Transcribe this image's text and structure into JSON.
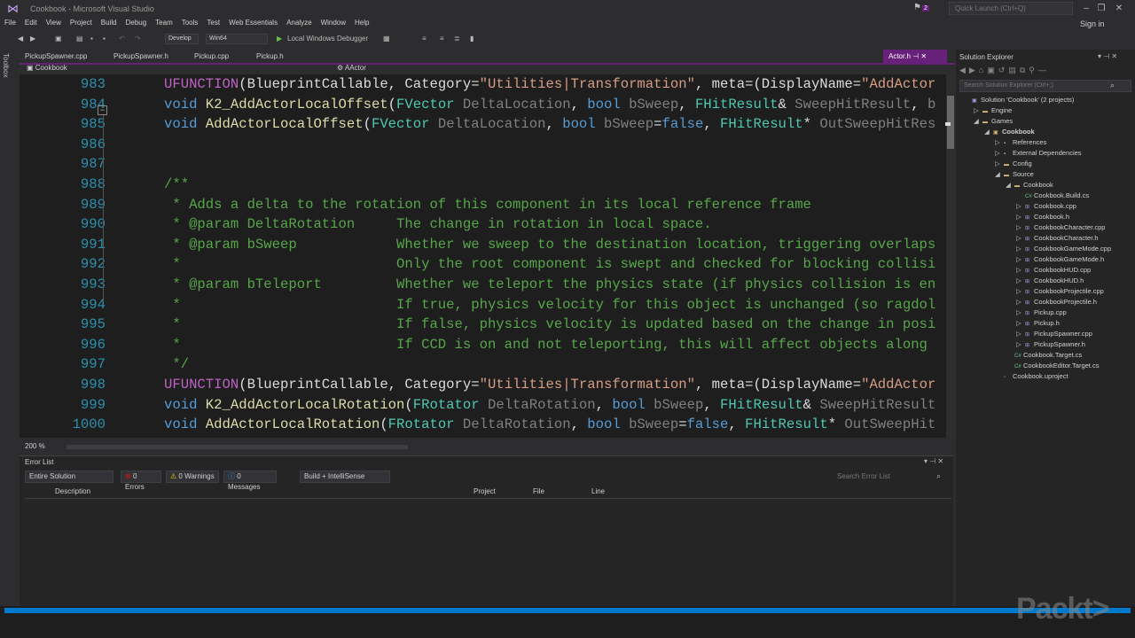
{
  "window": {
    "title": "Cookbook - Microsoft Visual Studio",
    "quick_launch_placeholder": "Quick Launch (Ctrl+Q)",
    "notification_count": "2",
    "sign_in": "Sign in"
  },
  "menu": [
    "File",
    "Edit",
    "View",
    "Project",
    "Build",
    "Debug",
    "Team",
    "Tools",
    "Test",
    "Web Essentials",
    "Analyze",
    "Window",
    "Help"
  ],
  "toolbar": {
    "configuration": "Develop",
    "platform": "Win64",
    "debugger": "Local Windows Debugger"
  },
  "toolbox_label": "Toolbox",
  "tabs": [
    "PickupSpawner.cpp",
    "PickupSpawner.h",
    "Pickup.cpp",
    "Pickup.h"
  ],
  "active_tab": "Actor.h",
  "nav": {
    "project": "Cookbook",
    "scope": "AActor"
  },
  "editor": {
    "zoom": "200 %",
    "lines": [
      {
        "n": "983",
        "segs": [
          [
            "mc",
            "UFUNCTION"
          ],
          [
            "pl",
            "(BlueprintCallable, Category="
          ],
          [
            "st",
            "\"Utilities|Transformation\""
          ],
          [
            "pl",
            ", meta=(DisplayName="
          ],
          [
            "st",
            "\"AddActor"
          ]
        ]
      },
      {
        "n": "984",
        "segs": [
          [
            "kw",
            "void"
          ],
          [
            "pl",
            " "
          ],
          [
            "fn",
            "K2_AddActorLocalOffset"
          ],
          [
            "pl",
            "("
          ],
          [
            "ty",
            "FVector"
          ],
          [
            "pl",
            " "
          ],
          [
            "pm",
            "DeltaLocation"
          ],
          [
            "pl",
            ", "
          ],
          [
            "kw",
            "bool"
          ],
          [
            "pl",
            " "
          ],
          [
            "pm",
            "bSweep"
          ],
          [
            "pl",
            ", "
          ],
          [
            "ty",
            "FHitResult"
          ],
          [
            "pl",
            "& "
          ],
          [
            "pm",
            "SweepHitResult"
          ],
          [
            "pl",
            ", "
          ],
          [
            "pm",
            "b"
          ]
        ]
      },
      {
        "n": "985",
        "segs": [
          [
            "kw",
            "void"
          ],
          [
            "pl",
            " "
          ],
          [
            "fn",
            "AddActorLocalOffset"
          ],
          [
            "pl",
            "("
          ],
          [
            "ty",
            "FVector"
          ],
          [
            "pl",
            " "
          ],
          [
            "pm",
            "DeltaLocation"
          ],
          [
            "pl",
            ", "
          ],
          [
            "kw",
            "bool"
          ],
          [
            "pl",
            " "
          ],
          [
            "pm",
            "bSweep"
          ],
          [
            "pl",
            "="
          ],
          [
            "kw",
            "false"
          ],
          [
            "pl",
            ", "
          ],
          [
            "ty",
            "FHitResult"
          ],
          [
            "pl",
            "* "
          ],
          [
            "pm",
            "OutSweepHitRes"
          ]
        ]
      },
      {
        "n": "986",
        "segs": []
      },
      {
        "n": "987",
        "segs": []
      },
      {
        "n": "988",
        "segs": [
          [
            "cm",
            "/**"
          ]
        ]
      },
      {
        "n": "989",
        "segs": [
          [
            "cm",
            " * Adds a delta to the rotation of this component in its local reference frame"
          ]
        ]
      },
      {
        "n": "990",
        "segs": [
          [
            "cm",
            " * @param DeltaRotation     The change in rotation in local space."
          ]
        ]
      },
      {
        "n": "991",
        "segs": [
          [
            "cm",
            " * @param bSweep            Whether we sweep to the destination location, triggering overlaps"
          ]
        ]
      },
      {
        "n": "992",
        "segs": [
          [
            "cm",
            " *                          Only the root component is swept and checked for blocking collisi"
          ]
        ]
      },
      {
        "n": "993",
        "segs": [
          [
            "cm",
            " * @param bTeleport         Whether we teleport the physics state (if physics collision is en"
          ]
        ]
      },
      {
        "n": "994",
        "segs": [
          [
            "cm",
            " *                          If true, physics velocity for this object is unchanged (so ragdol"
          ]
        ]
      },
      {
        "n": "995",
        "segs": [
          [
            "cm",
            " *                          If false, physics velocity is updated based on the change in posi"
          ]
        ]
      },
      {
        "n": "996",
        "segs": [
          [
            "cm",
            " *                          If CCD is on and not teleporting, this will affect objects along "
          ]
        ]
      },
      {
        "n": "997",
        "segs": [
          [
            "cm",
            " */"
          ]
        ]
      },
      {
        "n": "998",
        "segs": [
          [
            "mc",
            "UFUNCTION"
          ],
          [
            "pl",
            "(BlueprintCallable, Category="
          ],
          [
            "st",
            "\"Utilities|Transformation\""
          ],
          [
            "pl",
            ", meta=(DisplayName="
          ],
          [
            "st",
            "\"AddActor"
          ]
        ]
      },
      {
        "n": "999",
        "segs": [
          [
            "kw",
            "void"
          ],
          [
            "pl",
            " "
          ],
          [
            "fn",
            "K2_AddActorLocalRotation"
          ],
          [
            "pl",
            "("
          ],
          [
            "ty",
            "FRotator"
          ],
          [
            "pl",
            " "
          ],
          [
            "pm",
            "DeltaRotation"
          ],
          [
            "pl",
            ", "
          ],
          [
            "kw",
            "bool"
          ],
          [
            "pl",
            " "
          ],
          [
            "pm",
            "bSweep"
          ],
          [
            "pl",
            ", "
          ],
          [
            "ty",
            "FHitResult"
          ],
          [
            "pl",
            "& "
          ],
          [
            "pm",
            "SweepHitResult"
          ]
        ]
      },
      {
        "n": "1000",
        "segs": [
          [
            "kw",
            "void"
          ],
          [
            "pl",
            " "
          ],
          [
            "fn",
            "AddActorLocalRotation"
          ],
          [
            "pl",
            "("
          ],
          [
            "ty",
            "FRotator"
          ],
          [
            "pl",
            " "
          ],
          [
            "pm",
            "DeltaRotation"
          ],
          [
            "pl",
            ", "
          ],
          [
            "kw",
            "bool"
          ],
          [
            "pl",
            " "
          ],
          [
            "pm",
            "bSweep"
          ],
          [
            "pl",
            "="
          ],
          [
            "kw",
            "false"
          ],
          [
            "pl",
            ", "
          ],
          [
            "ty",
            "FHitResult"
          ],
          [
            "pl",
            "* "
          ],
          [
            "pm",
            "OutSweepHit"
          ]
        ]
      }
    ]
  },
  "error_list": {
    "title": "Error List",
    "scope": "Entire Solution",
    "errors": "0 Errors",
    "warnings": "0 Warnings",
    "messages": "0 Messages",
    "source": "Build + IntelliSense",
    "search_placeholder": "Search Error List",
    "columns": [
      "Description",
      "Project",
      "File",
      "Line"
    ]
  },
  "solution_explorer": {
    "title": "Solution Explorer",
    "search_placeholder": "Search Solution Explorer (Ctrl+;)",
    "items": [
      {
        "label": "Solution 'Cookbook' (2 projects)",
        "depth": 0,
        "arrow": "",
        "kind": "solution"
      },
      {
        "label": "Engine",
        "depth": 1,
        "arrow": "▷",
        "kind": "folder"
      },
      {
        "label": "Games",
        "depth": 1,
        "arrow": "◢",
        "kind": "folder"
      },
      {
        "label": "Cookbook",
        "depth": 2,
        "arrow": "◢",
        "kind": "project"
      },
      {
        "label": "References",
        "depth": 3,
        "arrow": "▷",
        "kind": "ref"
      },
      {
        "label": "External Dependencies",
        "depth": 3,
        "arrow": "▷",
        "kind": "ref"
      },
      {
        "label": "Config",
        "depth": 3,
        "arrow": "▷",
        "kind": "folder"
      },
      {
        "label": "Source",
        "depth": 3,
        "arrow": "◢",
        "kind": "folder"
      },
      {
        "label": "Cookbook",
        "depth": 4,
        "arrow": "◢",
        "kind": "folder"
      },
      {
        "label": "Cookbook.Build.cs",
        "depth": 5,
        "arrow": "",
        "kind": "cs"
      },
      {
        "label": "Cookbook.cpp",
        "depth": 5,
        "arrow": "▷",
        "kind": "cpp"
      },
      {
        "label": "Cookbook.h",
        "depth": 5,
        "arrow": "▷",
        "kind": "h"
      },
      {
        "label": "CookbookCharacter.cpp",
        "depth": 5,
        "arrow": "▷",
        "kind": "cpp"
      },
      {
        "label": "CookbookCharacter.h",
        "depth": 5,
        "arrow": "▷",
        "kind": "h"
      },
      {
        "label": "CookbookGameMode.cpp",
        "depth": 5,
        "arrow": "▷",
        "kind": "cpp"
      },
      {
        "label": "CookbookGameMode.h",
        "depth": 5,
        "arrow": "▷",
        "kind": "h"
      },
      {
        "label": "CookbookHUD.cpp",
        "depth": 5,
        "arrow": "▷",
        "kind": "cpp"
      },
      {
        "label": "CookbookHUD.h",
        "depth": 5,
        "arrow": "▷",
        "kind": "h"
      },
      {
        "label": "CookbookProjectile.cpp",
        "depth": 5,
        "arrow": "▷",
        "kind": "cpp"
      },
      {
        "label": "CookbookProjectile.h",
        "depth": 5,
        "arrow": "▷",
        "kind": "h"
      },
      {
        "label": "Pickup.cpp",
        "depth": 5,
        "arrow": "▷",
        "kind": "cpp"
      },
      {
        "label": "Pickup.h",
        "depth": 5,
        "arrow": "▷",
        "kind": "h"
      },
      {
        "label": "PickupSpawner.cpp",
        "depth": 5,
        "arrow": "▷",
        "kind": "cpp"
      },
      {
        "label": "PickupSpawner.h",
        "depth": 5,
        "arrow": "▷",
        "kind": "h"
      },
      {
        "label": "Cookbook.Target.cs",
        "depth": 4,
        "arrow": "",
        "kind": "cs"
      },
      {
        "label": "CookbookEditor.Target.cs",
        "depth": 4,
        "arrow": "",
        "kind": "cs"
      },
      {
        "label": "Cookbook.uproject",
        "depth": 3,
        "arrow": "",
        "kind": "file"
      }
    ]
  },
  "watermark": "Packt>",
  "colors": {
    "accent": "#68217a",
    "statusbar": "#007acc",
    "editor_bg": "#1e1e1e"
  }
}
